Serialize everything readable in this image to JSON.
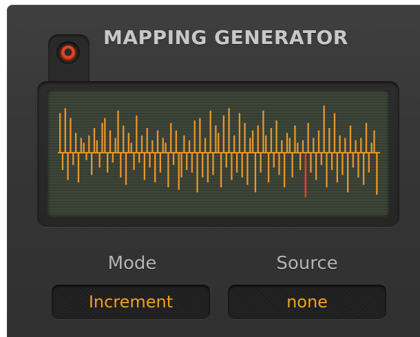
{
  "title": "MAPPING GENERATOR",
  "power_led": {
    "icon": "power-led-icon",
    "color": "#e04520"
  },
  "mode": {
    "label": "Mode",
    "value": "Increment"
  },
  "source": {
    "label": "Source",
    "value": "none"
  },
  "display": {
    "bar_color": "#e8962c",
    "highlight_color": "#ff3b2a",
    "highlight_index": 93,
    "values": [
      0.8,
      -0.35,
      0.9,
      -0.55,
      0.7,
      -0.25,
      0.4,
      -0.6,
      0.3,
      0.2,
      -0.15,
      0.35,
      -0.45,
      0.5,
      0.25,
      -0.3,
      0.6,
      0.7,
      -0.4,
      0.45,
      -0.2,
      0.3,
      0.85,
      -0.5,
      0.55,
      -0.65,
      0.4,
      0.2,
      -0.35,
      0.75,
      -0.2,
      0.35,
      -0.55,
      0.5,
      -0.3,
      0.25,
      -0.6,
      0.45,
      -0.4,
      0.3,
      0.2,
      -0.7,
      0.6,
      -0.25,
      0.45,
      -0.75,
      -0.5,
      0.35,
      -0.35,
      0.25,
      -0.4,
      0.65,
      -0.8,
      0.7,
      -0.5,
      0.3,
      -0.6,
      0.85,
      -0.45,
      0.55,
      0.4,
      -0.7,
      0.75,
      -0.3,
      0.9,
      -0.55,
      0.35,
      -0.4,
      0.8,
      -0.5,
      0.6,
      -0.65,
      0.3,
      0.45,
      -0.8,
      0.55,
      -0.4,
      0.85,
      0.35,
      -0.6,
      0.5,
      -0.3,
      0.65,
      -0.45,
      0.25,
      -0.7,
      0.4,
      0.3,
      -0.5,
      0.55,
      0.2,
      -0.35,
      0.25,
      -0.9,
      0.6,
      -0.4,
      0.3,
      -0.55,
      0.45,
      -0.25,
      0.95,
      -0.7,
      0.5,
      -0.35,
      0.8,
      -0.6,
      0.35,
      -0.45,
      0.3,
      -0.8,
      0.55,
      -0.3,
      0.25,
      -0.5,
      0.3,
      -0.65,
      0.6,
      -0.4,
      0.2,
      0.45,
      -0.85
    ]
  }
}
